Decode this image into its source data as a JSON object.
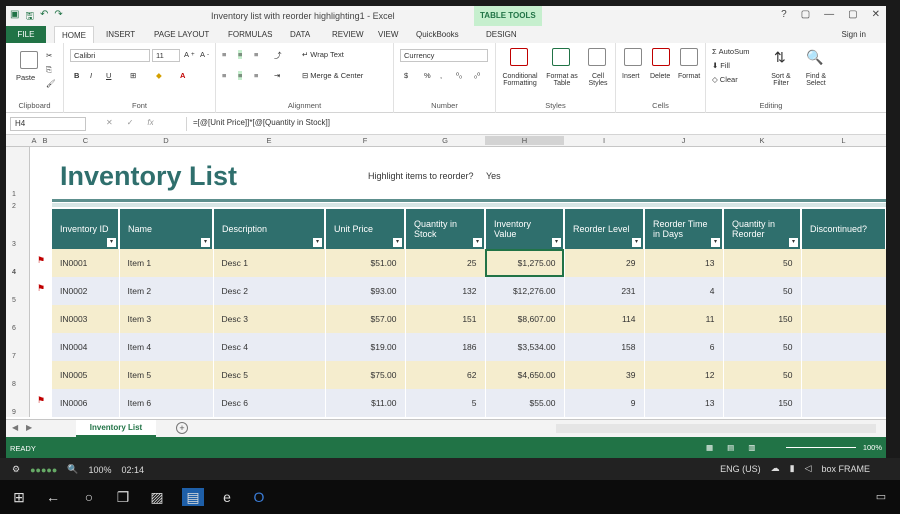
{
  "window": {
    "title": "Inventory list with reorder highlighting1 - Excel",
    "table_tools": "TABLE TOOLS",
    "controls": [
      "?",
      "▢",
      "—",
      "▢",
      "✕"
    ]
  },
  "tabs": {
    "file": "FILE",
    "items": [
      "HOME",
      "INSERT",
      "PAGE LAYOUT",
      "FORMULAS",
      "DATA",
      "REVIEW",
      "VIEW",
      "QuickBooks",
      "DESIGN"
    ],
    "sign_in": "Sign in"
  },
  "ribbon": {
    "clipboard": {
      "paste": "Paste",
      "label": "Clipboard"
    },
    "font": {
      "name": "Calibri",
      "size": "11",
      "bold": "B",
      "italic": "I",
      "underline": "U",
      "label": "Font"
    },
    "alignment": {
      "wrap": "Wrap Text",
      "merge": "Merge & Center",
      "label": "Alignment"
    },
    "number": {
      "format": "Currency",
      "currency": "$",
      "percent": "%",
      "comma": ",",
      "label": "Number"
    },
    "styles": {
      "conditional": "Conditional Formatting",
      "format_table": "Format as Table",
      "cell_styles": "Cell Styles",
      "label": "Styles"
    },
    "cells": {
      "insert": "Insert",
      "delete": "Delete",
      "format": "Format",
      "label": "Cells"
    },
    "editing": {
      "autosum": "AutoSum",
      "fill": "Fill",
      "clear": "Clear",
      "sort": "Sort & Filter",
      "find": "Find & Select",
      "label": "Editing"
    }
  },
  "formula_bar": {
    "cell": "H4",
    "fx": "fx",
    "formula": "=[@[Unit Price]]*[@[Quantity in Stock]]"
  },
  "columns": [
    "A",
    "B",
    "C",
    "D",
    "E",
    "F",
    "G",
    "H",
    "I",
    "J",
    "K",
    "L"
  ],
  "rows": [
    "1",
    "2",
    "3",
    "4",
    "5",
    "6",
    "7",
    "8",
    "9"
  ],
  "sheet": {
    "title": "Inventory List",
    "highlight_question": "Highlight items to reorder?",
    "highlight_answer": "Yes",
    "headers": [
      "Inventory ID",
      "Name",
      "Description",
      "Unit Price",
      "Quantity in Stock",
      "Inventory Value",
      "Reorder Level",
      "Reorder Time in Days",
      "Quantity in Reorder",
      "Discontinued?"
    ],
    "data": [
      [
        "IN0001",
        "Item 1",
        "Desc 1",
        "$51.00",
        "25",
        "$1,275.00",
        "29",
        "13",
        "50",
        ""
      ],
      [
        "IN0002",
        "Item 2",
        "Desc 2",
        "$93.00",
        "132",
        "$12,276.00",
        "231",
        "4",
        "50",
        ""
      ],
      [
        "IN0003",
        "Item 3",
        "Desc 3",
        "$57.00",
        "151",
        "$8,607.00",
        "114",
        "11",
        "150",
        ""
      ],
      [
        "IN0004",
        "Item 4",
        "Desc 4",
        "$19.00",
        "186",
        "$3,534.00",
        "158",
        "6",
        "50",
        ""
      ],
      [
        "IN0005",
        "Item 5",
        "Desc 5",
        "$75.00",
        "62",
        "$4,650.00",
        "39",
        "12",
        "50",
        ""
      ],
      [
        "IN0006",
        "Item 6",
        "Desc 6",
        "$11.00",
        "5",
        "$55.00",
        "9",
        "13",
        "150",
        ""
      ]
    ],
    "flagged": [
      true,
      true,
      false,
      false,
      false,
      true
    ]
  },
  "sheet_tab": "Inventory List",
  "status": {
    "ready": "READY",
    "zoom": "100%"
  },
  "os": {
    "zoom": "100%",
    "time": "02:14",
    "lang": "ENG (US)",
    "brand": "box FRAME"
  },
  "colors": {
    "excel_green": "#217346",
    "table_header": "#2f6f6d",
    "row_odd": "#f5edce",
    "row_even": "#e9ecf4"
  }
}
